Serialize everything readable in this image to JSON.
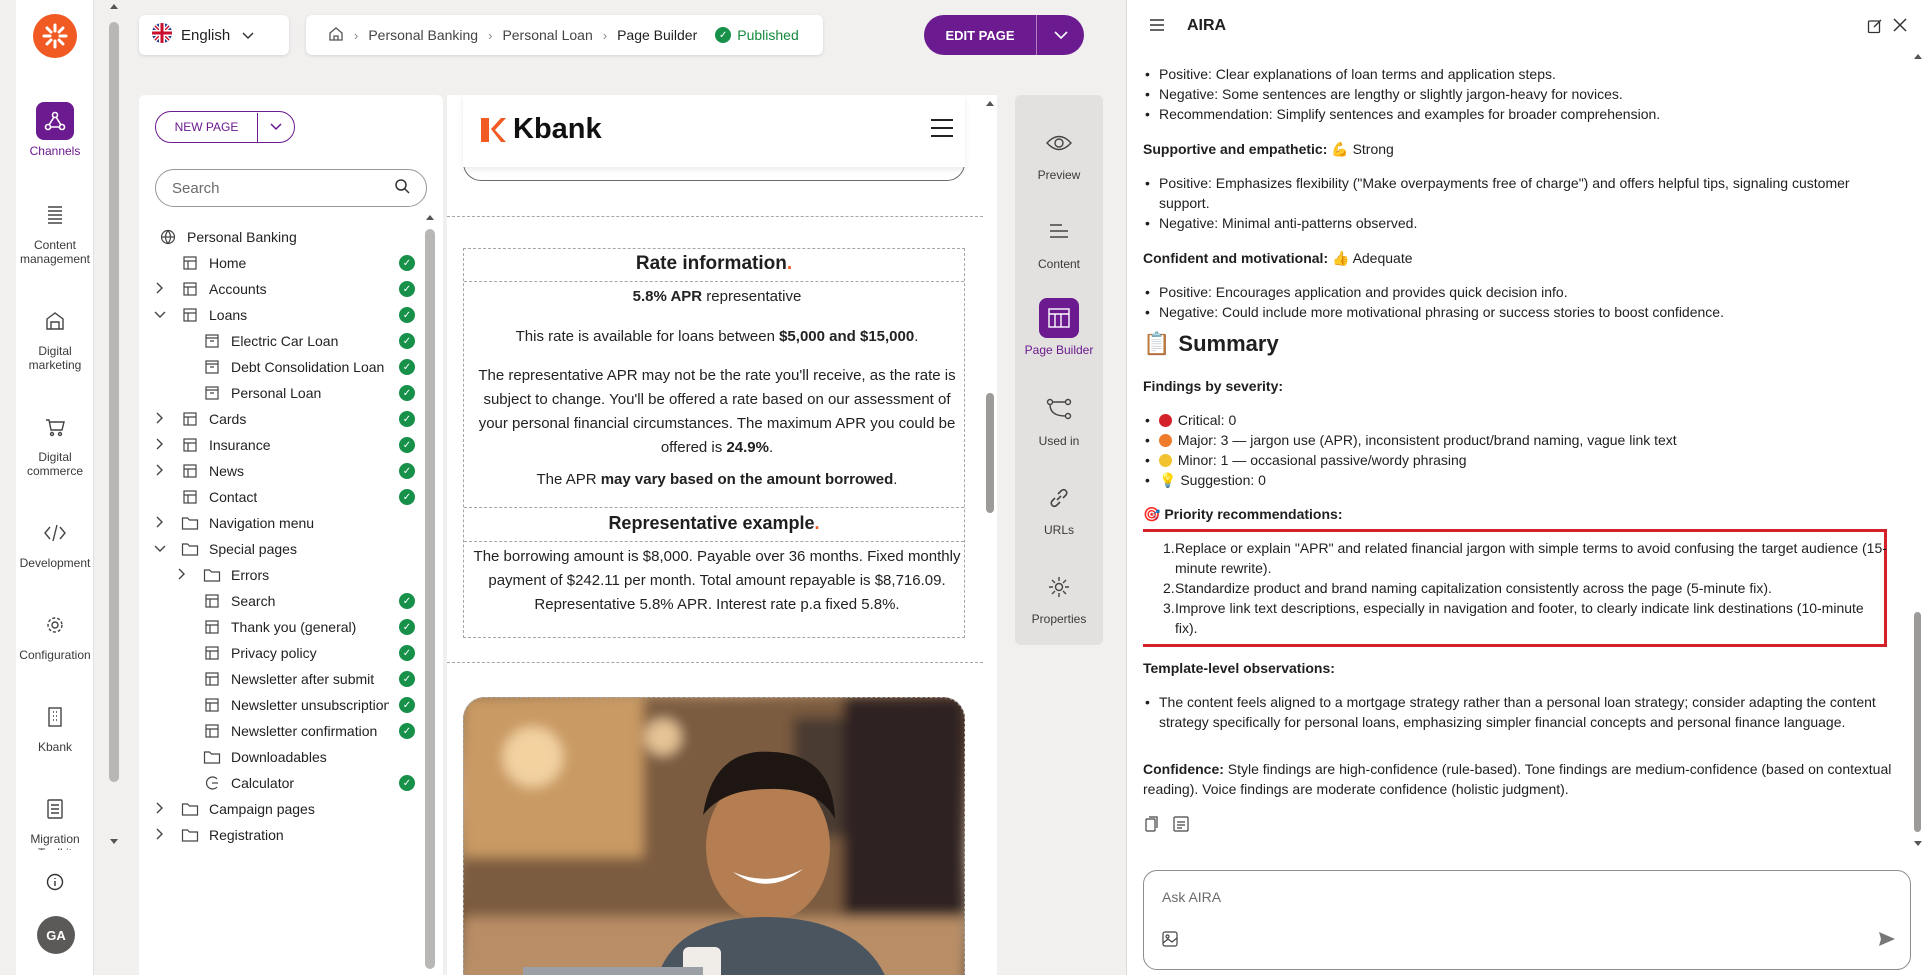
{
  "rail": {
    "items": [
      {
        "label": "Channels"
      },
      {
        "label": "Content management"
      },
      {
        "label": "Digital marketing"
      },
      {
        "label": "Digital commerce"
      },
      {
        "label": "Development"
      },
      {
        "label": "Configuration"
      },
      {
        "label": "Kbank"
      },
      {
        "label": "Migration Toolkit"
      }
    ],
    "avatar": "GA"
  },
  "topbar": {
    "language": "English",
    "breadcrumb": [
      "Personal Banking",
      "Personal Loan",
      "Page Builder"
    ],
    "status": "Published",
    "edit_label": "EDIT PAGE"
  },
  "tree": {
    "new_page_label": "NEW PAGE",
    "search_placeholder": "Search",
    "nodes": [
      {
        "label": "Personal Banking"
      },
      {
        "label": "Home"
      },
      {
        "label": "Accounts"
      },
      {
        "label": "Loans"
      },
      {
        "label": "Electric Car Loan"
      },
      {
        "label": "Debt Consolidation Loan"
      },
      {
        "label": "Personal Loan"
      },
      {
        "label": "Cards"
      },
      {
        "label": "Insurance"
      },
      {
        "label": "News"
      },
      {
        "label": "Contact"
      },
      {
        "label": "Navigation menu"
      },
      {
        "label": "Special pages"
      },
      {
        "label": "Errors"
      },
      {
        "label": "Search"
      },
      {
        "label": "Thank you (general)"
      },
      {
        "label": "Privacy policy"
      },
      {
        "label": "Newsletter after submit"
      },
      {
        "label": "Newsletter unsubscription"
      },
      {
        "label": "Newsletter confirmation"
      },
      {
        "label": "Downloadables"
      },
      {
        "label": "Calculator"
      },
      {
        "label": "Campaign pages"
      },
      {
        "label": "Registration"
      }
    ]
  },
  "preview": {
    "brand": "Kbank",
    "rate_title": "Rate information",
    "apr_bold": "5.8% APR",
    "apr_rest": " representative",
    "avail_pre": "This rate is available for loans between ",
    "avail_bold": "$5,000 and $15,000",
    "rep_apr_text": "The representative APR may not be the rate you'll receive, as the rate is subject to change. You'll be offered a rate based on our assessment of your personal financial circumstances. The maximum APR you could be offered is ",
    "max_apr": "24.9%",
    "vary_pre": "The APR ",
    "vary_bold": "may vary based on the amount borrowed",
    "example_title": "Representative example",
    "example_text": "The borrowing amount is $8,000. Payable over 36 months. Fixed monthly payment of $242.11 per month. Total amount repayable is $8,716.09. Representative 5.8% APR. Interest rate p.a fixed 5.8%."
  },
  "tools": [
    {
      "label": "Preview"
    },
    {
      "label": "Content"
    },
    {
      "label": "Page Builder"
    },
    {
      "label": "Used in"
    },
    {
      "label": "URLs"
    },
    {
      "label": "Properties"
    }
  ],
  "aira": {
    "title": "AIRA",
    "lines": {
      "l1": "Positive: Clear explanations of loan terms and application steps.",
      "l2": "Negative: Some sentences are lengthy or slightly jargon-heavy for novices.",
      "l3": "Recommendation: Simplify sentences and examples for broader comprehension.",
      "supportive_h": "Supportive and empathetic:",
      "supportive_v": "Strong",
      "s1": "Positive: Emphasizes flexibility (\"Make overpayments free of charge\") and offers helpful tips, signaling customer support.",
      "s2": "Negative: Minimal anti-patterns observed.",
      "confident_h": "Confident and motivational:",
      "confident_v": "Adequate",
      "c1": "Positive: Encourages application and provides quick decision info.",
      "c2": "Negative: Could include more motivational phrasing or success stories to boost confidence.",
      "summary_h": "Summary",
      "severity_h": "Findings by severity:",
      "sev1": "Critical: 0",
      "sev2": "Major: 3 — jargon use (APR), inconsistent product/brand naming, vague link text",
      "sev3": "Minor: 1 — occasional passive/wordy phrasing",
      "sev4": "Suggestion: 0",
      "priority_h": "Priority recommendations:",
      "r1": "Replace or explain \"APR\" and related financial jargon with simple terms to avoid confusing the target audience (15-minute rewrite).",
      "r2": "Standardize product and brand naming capitalization consistently across the page (5-minute fix).",
      "r3": "Improve link text descriptions, especially in navigation and footer, to clearly indicate link destinations (10-minute fix).",
      "template_h": "Template-level observations:",
      "t1": "The content feels aligned to a mortgage strategy rather than a personal loan strategy; consider adapting the content strategy specifically for personal loans, emphasizing simpler financial concepts and personal finance language.",
      "confidence_h": "Confidence:",
      "confidence_t": " Style findings are high-confidence (rule-based). Tone findings are medium-confidence (based on contextual reading). Voice findings are moderate confidence (holistic judgment)."
    },
    "ask_placeholder": "Ask AIRA"
  },
  "colors": {
    "accent": "#6b1a8f",
    "brand_orange": "#f15a22",
    "published_green": "#17914a",
    "highlight_red": "#d3222a"
  }
}
